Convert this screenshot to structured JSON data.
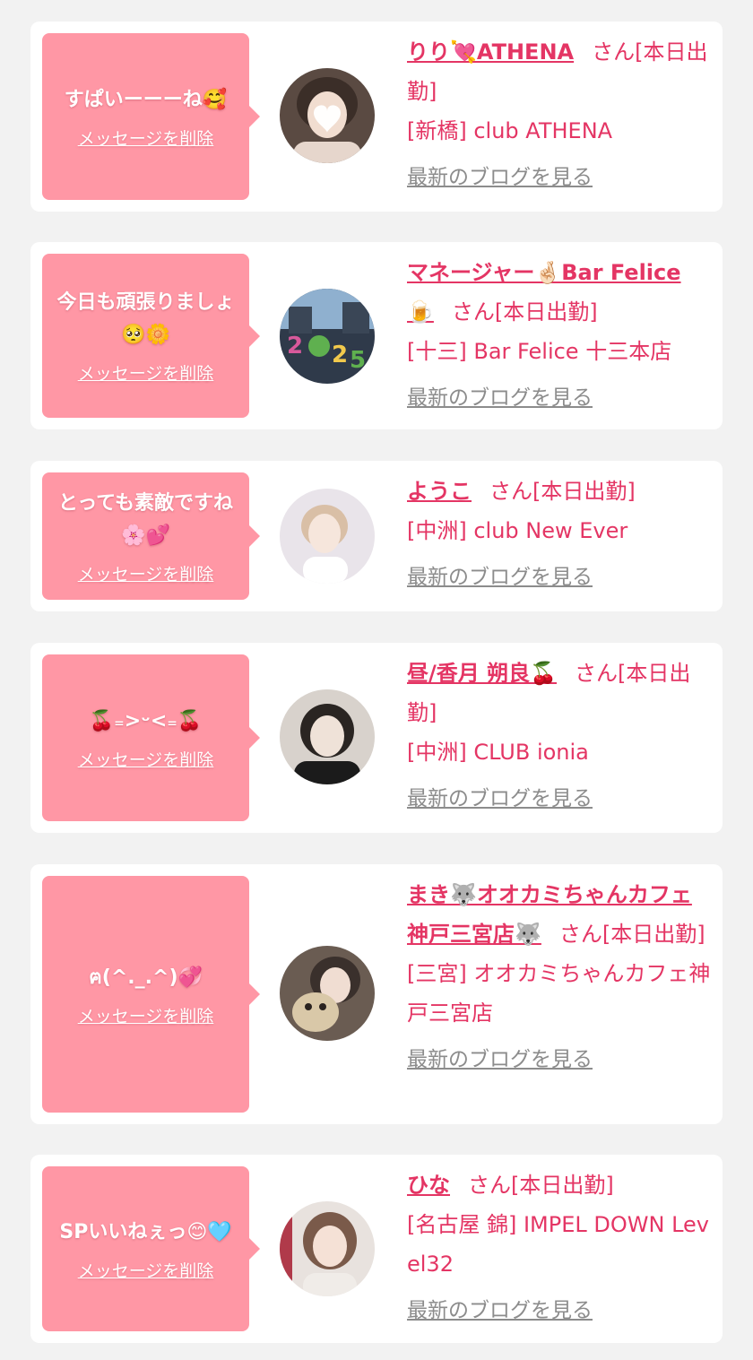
{
  "entries": [
    {
      "message": "すぱいーーーね🥰",
      "delete_label": "メッセージを削除",
      "name": "りり💘ATHENA",
      "honorific": "さん",
      "status": "[本日出勤]",
      "store": "[新橋] club ATHENA",
      "blog_label": "最新のブログを見る",
      "avatar": {
        "name": "avatar-photo",
        "bg": "#5a4a42",
        "face": "#f1ddd0",
        "hair": "#3b2e28"
      }
    },
    {
      "message": "今日も頑張りましょ🥺🌼",
      "delete_label": "メッセージを削除",
      "name": "マネージャー🤞🏻Bar Felice 🍺",
      "honorific": "さん",
      "status": "[本日出勤]",
      "store": "[十三] Bar Felice 十三本店",
      "blog_label": "最新のブログを見る",
      "avatar": {
        "name": "avatar-photo",
        "bg": "#2f3a4a",
        "face": "#8fb0cf",
        "hair": "#1f2630"
      }
    },
    {
      "message": "とっても素敵ですね🌸💕",
      "delete_label": "メッセージを削除",
      "name": "ようこ",
      "honorific": "さん",
      "status": "[本日出勤]",
      "store": "[中洲] club New Ever",
      "blog_label": "最新のブログを見る",
      "avatar": {
        "name": "avatar-photo",
        "bg": "#e9e4ea",
        "face": "#f6e6dc",
        "hair": "#d9bfa6"
      }
    },
    {
      "message": "🍒₌>ᵕ<₌🍒",
      "delete_label": "メッセージを削除",
      "name": "昼/香月 朔良🍒",
      "honorific": "さん",
      "status": "[本日出勤]",
      "store": "[中洲] CLUB ionia",
      "blog_label": "最新のブログを見る",
      "avatar": {
        "name": "avatar-photo",
        "bg": "#d8d2cc",
        "face": "#efe2d8",
        "hair": "#2a2522"
      }
    },
    {
      "message": "ฅ(^._.^)💞",
      "delete_label": "メッセージを削除",
      "name": "まき🐺オオカミちゃんカフェ神戸三宮店🐺",
      "honorific": "さん",
      "status": "[本日出勤]",
      "store": "[三宮] オオカミちゃんカフェ神戸三宮店",
      "blog_label": "最新のブログを見る",
      "avatar": {
        "name": "avatar-photo",
        "bg": "#6a5c52",
        "face": "#f0ddd2",
        "hair": "#3a302c"
      }
    },
    {
      "message": "SPいいねぇっ😊🩵",
      "delete_label": "メッセージを削除",
      "name": "ひな",
      "honorific": "さん",
      "status": "[本日出勤]",
      "store": "[名古屋 錦] IMPEL DOWN Level32",
      "blog_label": "最新のブログを見る",
      "avatar": {
        "name": "avatar-photo",
        "bg": "#e8e2de",
        "face": "#f5e1d6",
        "hair": "#7a5a4a"
      }
    }
  ]
}
